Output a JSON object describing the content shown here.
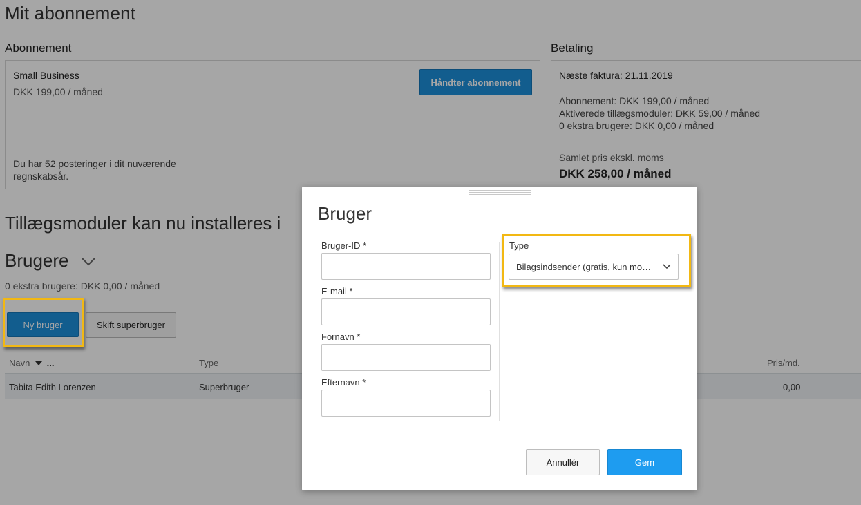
{
  "page": {
    "title": "Mit abonnement",
    "subscription": {
      "section_label": "Abonnement",
      "plan_name": "Small Business",
      "plan_price": "DKK 199,00 / måned",
      "manage_button": "Håndter abonnement",
      "postings_note": "Du har 52 posteringer i dit nuværende regnskabsår."
    },
    "payment": {
      "section_label": "Betaling",
      "next_invoice": "Næste faktura: 21.11.2019",
      "lines": [
        "Abonnement: DKK 199,00 / måned",
        "Aktiverede tillægsmoduler: DKK 59,00 / måned",
        "0 ekstra brugere: DKK 0,00 / måned"
      ],
      "total_label": "Samlet pris ekskl. moms",
      "total_value": "DKK 258,00 / måned"
    },
    "addons_banner": "Tillægsmoduler kan nu installeres i",
    "users": {
      "title": "Brugere",
      "subtitle": "0 ekstra brugere: DKK 0,00 / måned",
      "new_user_button": "Ny bruger",
      "switch_superuser_button": "Skift superbruger",
      "columns": {
        "name": "Navn",
        "name_more": "...",
        "type": "Type",
        "price": "Pris/md."
      },
      "rows": [
        {
          "name": "Tabita Edith Lorenzen",
          "type": "Superbruger",
          "price": "0,00"
        }
      ]
    }
  },
  "modal": {
    "title": "Bruger",
    "fields": {
      "user_id_label": "Bruger-ID *",
      "email_label": "E-mail *",
      "first_name_label": "Fornavn *",
      "last_name_label": "Efternavn *",
      "type_label": "Type",
      "type_value": "Bilagsindsender (gratis, kun mo…"
    },
    "cancel_button": "Annullér",
    "save_button": "Gem"
  },
  "colors": {
    "primary_button": "#1d8fdb",
    "save_button": "#1e9cf0",
    "highlight": "#f2b813",
    "overlay": "rgba(0,0,0,0.35)"
  },
  "icons": {
    "users_toggle": "chevron-down-icon",
    "sort": "sort-desc-icon",
    "type_select": "chevron-down-icon",
    "drag_handle": "drag-handle-icon"
  }
}
